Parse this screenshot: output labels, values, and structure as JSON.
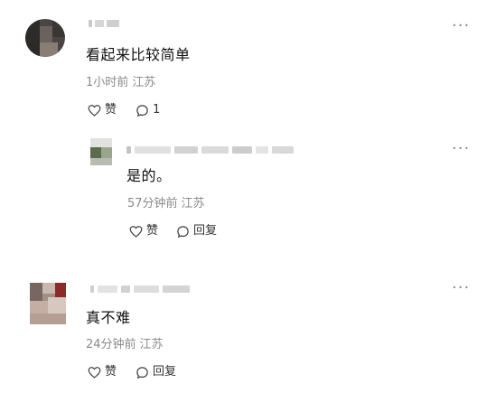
{
  "comments": [
    {
      "text": "看起来比较简单",
      "time": "1小时前",
      "location": "江苏",
      "like_label": "赞",
      "reply_count": "1",
      "more": "···"
    },
    {
      "text": "是的。",
      "time": "57分钟前",
      "location": "江苏",
      "like_label": "赞",
      "reply_label": "回复",
      "more": "···"
    },
    {
      "text": "真不难",
      "time": "24分钟前",
      "location": "江苏",
      "like_label": "赞",
      "reply_label": "回复",
      "more": "···"
    }
  ]
}
